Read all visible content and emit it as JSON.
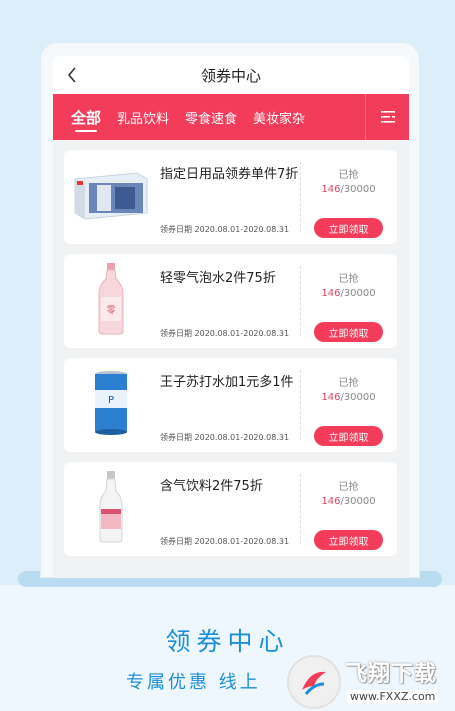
{
  "header": {
    "title": "领券中心"
  },
  "tabs": [
    {
      "label": "全部"
    },
    {
      "label": "乳品饮料"
    },
    {
      "label": "零食速食"
    },
    {
      "label": "美妆家杂"
    }
  ],
  "coupons": [
    {
      "name": "指定日用品领券单件7折",
      "date": "领券日期 2020.08.01-2020.08.31",
      "grabbed_label": "已抢",
      "claimed": "146",
      "total": "/30000",
      "button": "立即领取",
      "image_icon": "toy-box-icon"
    },
    {
      "name": "轻零气泡水2件75折",
      "date": "领券日期 2020.08.01-2020.08.31",
      "grabbed_label": "已抢",
      "claimed": "146",
      "total": "/30000",
      "button": "立即领取",
      "image_icon": "bottle-icon"
    },
    {
      "name": "王子苏打水加1元多1件",
      "date": "领券日期 2020.08.01-2020.08.31",
      "grabbed_label": "已抢",
      "claimed": "146",
      "total": "/30000",
      "button": "立即领取",
      "image_icon": "can-icon"
    },
    {
      "name": "含气饮料2件75折",
      "date": "领券日期 2020.08.01-2020.08.31",
      "grabbed_label": "已抢",
      "claimed": "146",
      "total": "/30000",
      "button": "立即领取",
      "image_icon": "bottle-icon"
    }
  ],
  "promo": {
    "title": "领券中心",
    "subtitle": "专属优惠 线上"
  },
  "watermark": {
    "name": "飞翔下载",
    "url": "www.FXXZ.com"
  },
  "colors": {
    "accent": "#f33b5a",
    "promo_blue": "#1e8fd6",
    "background": "#dceefa"
  }
}
